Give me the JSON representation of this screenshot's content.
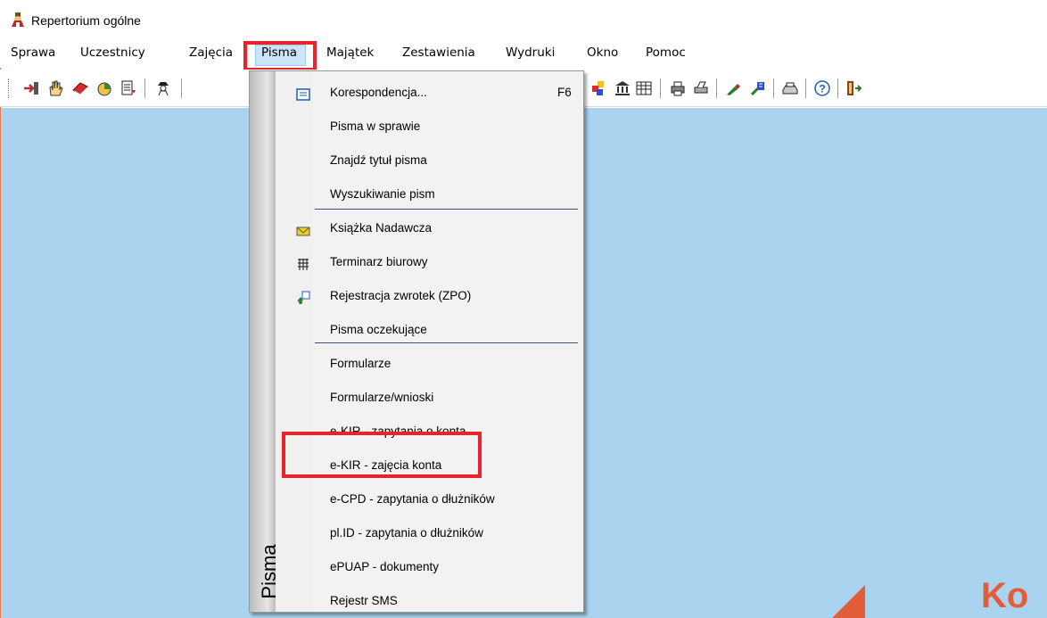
{
  "window": {
    "title": "Repertorium ogólne"
  },
  "menu_bar": {
    "items": [
      "Sprawa",
      "Uczestnicy",
      "Zajęcia",
      "Pisma",
      "Majątek",
      "Zestawienia",
      "Wydruki",
      "Okno",
      "Pomoc"
    ],
    "active": "Pisma"
  },
  "toolbar": {
    "icons": [
      "login-icon",
      "hand-icon",
      "book-icon",
      "pie-chart-icon",
      "document-icon",
      "agent-icon",
      "palette-icon",
      "bank-icon",
      "columns-icon",
      "printer-icon",
      "printer-setup-icon",
      "pen-icon",
      "wizard-icon",
      "fax-icon",
      "help-icon",
      "exit-icon"
    ]
  },
  "dropdown": {
    "sidebar_label": "Pisma",
    "items": [
      {
        "label": "Korespondencja...",
        "shortcut": "F6",
        "icon": "letter-icon"
      },
      {
        "label": "Pisma w sprawie"
      },
      {
        "label": "Znajdź tytuł pisma"
      },
      {
        "label": "Wyszukiwanie pism"
      },
      {
        "label": "Książka Nadawcza",
        "icon": "envelope-icon"
      },
      {
        "label": "Terminarz biurowy",
        "icon": "calendar-icon"
      },
      {
        "label": "Rejestracja zwrotek (ZPO)",
        "icon": "return-receipt-icon"
      },
      {
        "label": "Pisma oczekujące"
      },
      {
        "label": "Formularze"
      },
      {
        "label": "Formularze/wnioski"
      },
      {
        "label": "e-KIR - zapytania o konta"
      },
      {
        "label": "e-KIR - zajęcia konta",
        "highlighted": true
      },
      {
        "label": "e-CPD - zapytania o dłużników"
      },
      {
        "label": "pl.ID - zapytania o dłużników"
      },
      {
        "label": "ePUAP - dokumenty"
      },
      {
        "label": "Rejestr SMS"
      }
    ]
  },
  "background": {
    "logo_fragment": "Ko"
  },
  "colors": {
    "desktop": "#a9d3ee",
    "highlight": "#e8232b",
    "logo": "#e25d3a",
    "separator": "#3b4a7a"
  }
}
